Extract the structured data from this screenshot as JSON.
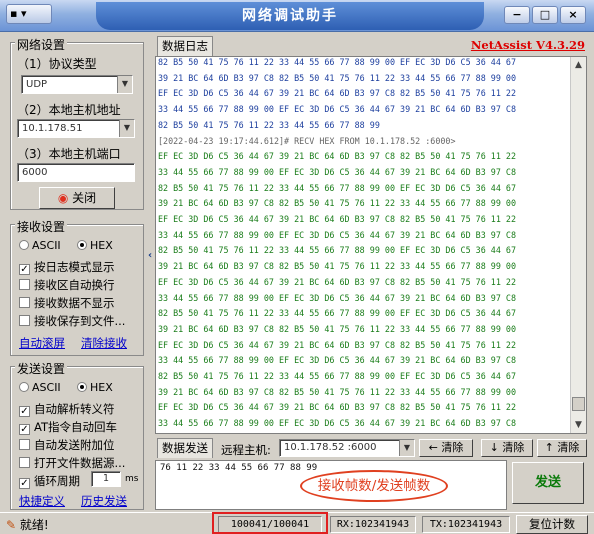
{
  "window": {
    "title": "网络调试助手",
    "menu_label": "▾",
    "min_label": "−",
    "max_label": "□",
    "close_label": "×"
  },
  "network": {
    "group_title": "网络设置",
    "protocol_label": "（1）协议类型",
    "protocol_value": "UDP",
    "local_ip_label": "（2）本地主机地址",
    "local_ip_value": "10.1.178.51",
    "local_port_label": "（3）本地主机端口",
    "local_port_value": "6000",
    "close_button": "关闭"
  },
  "receive": {
    "group_title": "接收设置",
    "ascii_label": "ASCII",
    "hex_label": "HEX",
    "options": [
      "按日志模式显示",
      "接收区自动换行",
      "接收数据不显示",
      "接收保存到文件..."
    ],
    "options_checked": [
      true,
      false,
      false,
      false
    ],
    "auto_scroll": "自动滚屏",
    "clear_receive": "清除接收"
  },
  "send_settings": {
    "group_title": "发送设置",
    "ascii_label": "ASCII",
    "hex_label": "HEX",
    "options": [
      "自动解析转义符",
      "AT指令自动回车",
      "自动发送附加位",
      "打开文件数据源..."
    ],
    "options_checked": [
      true,
      true,
      false,
      false
    ],
    "cycle_label": "循环周期",
    "cycle_value": "1",
    "cycle_unit": "ms",
    "shortcut_link": "快捷定义",
    "history_link": "历史发送"
  },
  "log": {
    "tab_label": "数据日志",
    "brand": "NetAssist V4.3.29",
    "lines": [
      {
        "c": "b",
        "t": "82 B5 50 41 75 76 11 22 33 44 55 66 77 88 99 00 EF EC 3D D6 C5 36 44 67"
      },
      {
        "c": "b",
        "t": "39 21 BC 64 6D B3 97 C8 82 B5 50 41 75 76 11 22 33 44 55 66 77 88 99 00"
      },
      {
        "c": "b",
        "t": "EF EC 3D D6 C5 36 44 67 39 21 BC 64 6D B3 97 C8 82 B5 50 41 75 76 11 22"
      },
      {
        "c": "b",
        "t": "33 44 55 66 77 88 99 00 EF EC 3D D6 C5 36 44 67 39 21 BC 64 6D B3 97 C8"
      },
      {
        "c": "b",
        "t": "82 B5 50 41 75 76 11 22 33 44 55 66 77 88 99"
      },
      {
        "c": "r",
        "t": "[2022-04-23 19:17:44.612]# RECV HEX FROM 10.1.178.52 :6000>"
      },
      {
        "c": "g",
        "t": "EF EC 3D D6 C5 36 44 67 39 21 BC 64 6D B3 97 C8 82 B5 50 41 75 76 11 22"
      },
      {
        "c": "g",
        "t": "33 44 55 66 77 88 99 00 EF EC 3D D6 C5 36 44 67 39 21 BC 64 6D B3 97 C8"
      },
      {
        "c": "g",
        "t": "82 B5 50 41 75 76 11 22 33 44 55 66 77 88 99 00 EF EC 3D D6 C5 36 44 67"
      },
      {
        "c": "g",
        "t": "39 21 BC 64 6D B3 97 C8 82 B5 50 41 75 76 11 22 33 44 55 66 77 88 99 00"
      },
      {
        "c": "g",
        "t": "EF EC 3D D6 C5 36 44 67 39 21 BC 64 6D B3 97 C8 82 B5 50 41 75 76 11 22"
      },
      {
        "c": "g",
        "t": "33 44 55 66 77 88 99 00 EF EC 3D D6 C5 36 44 67 39 21 BC 64 6D B3 97 C8"
      },
      {
        "c": "g",
        "t": "82 B5 50 41 75 76 11 22 33 44 55 66 77 88 99 00 EF EC 3D D6 C5 36 44 67"
      },
      {
        "c": "g",
        "t": "39 21 BC 64 6D B3 97 C8 82 B5 50 41 75 76 11 22 33 44 55 66 77 88 99 00"
      },
      {
        "c": "g",
        "t": "EF EC 3D D6 C5 36 44 67 39 21 BC 64 6D B3 97 C8 82 B5 50 41 75 76 11 22"
      },
      {
        "c": "g",
        "t": "33 44 55 66 77 88 99 00 EF EC 3D D6 C5 36 44 67 39 21 BC 64 6D B3 97 C8"
      },
      {
        "c": "g",
        "t": "82 B5 50 41 75 76 11 22 33 44 55 66 77 88 99 00 EF EC 3D D6 C5 36 44 67"
      },
      {
        "c": "g",
        "t": "39 21 BC 64 6D B3 97 C8 82 B5 50 41 75 76 11 22 33 44 55 66 77 88 99 00"
      },
      {
        "c": "g",
        "t": "EF EC 3D D6 C5 36 44 67 39 21 BC 64 6D B3 97 C8 82 B5 50 41 75 76 11 22"
      },
      {
        "c": "g",
        "t": "33 44 55 66 77 88 99 00 EF EC 3D D6 C5 36 44 67 39 21 BC 64 6D B3 97 C8"
      },
      {
        "c": "g",
        "t": "82 B5 50 41 75 76 11 22 33 44 55 66 77 88 99 00 EF EC 3D D6 C5 36 44 67"
      },
      {
        "c": "g",
        "t": "39 21 BC 64 6D B3 97 C8 82 B5 50 41 75 76 11 22 33 44 55 66 77 88 99 00"
      },
      {
        "c": "g",
        "t": "EF EC 3D D6 C5 36 44 67 39 21 BC 64 6D B3 97 C8 82 B5 50 41 75 76 11 22"
      },
      {
        "c": "g",
        "t": "33 44 55 66 77 88 99 00 EF EC 3D D6 C5 36 44 67 39 21 BC 64 6D B3 97 C8"
      },
      {
        "c": "g",
        "t": "82 B5 50 41 75 76 11 22 33 44 55 66 77 88 99 00 EF EC 3D D6 C5 36 44 67"
      }
    ]
  },
  "sendbar": {
    "tab_label": "数据发送",
    "remote_label": "远程主机:",
    "remote_value": "10.1.178.52 :6000",
    "clear1": "清除",
    "clear2": "清除",
    "clear3": "清除"
  },
  "send": {
    "content": "76 11 22 33 44 55 66 77 88 99",
    "button": "发送",
    "annotation": "接收帧数/发送帧数"
  },
  "status": {
    "ready": "就绪!",
    "frames": "100041/100041",
    "rx": "RX:102341943",
    "tx": "TX:102341943",
    "reset": "复位计数"
  }
}
